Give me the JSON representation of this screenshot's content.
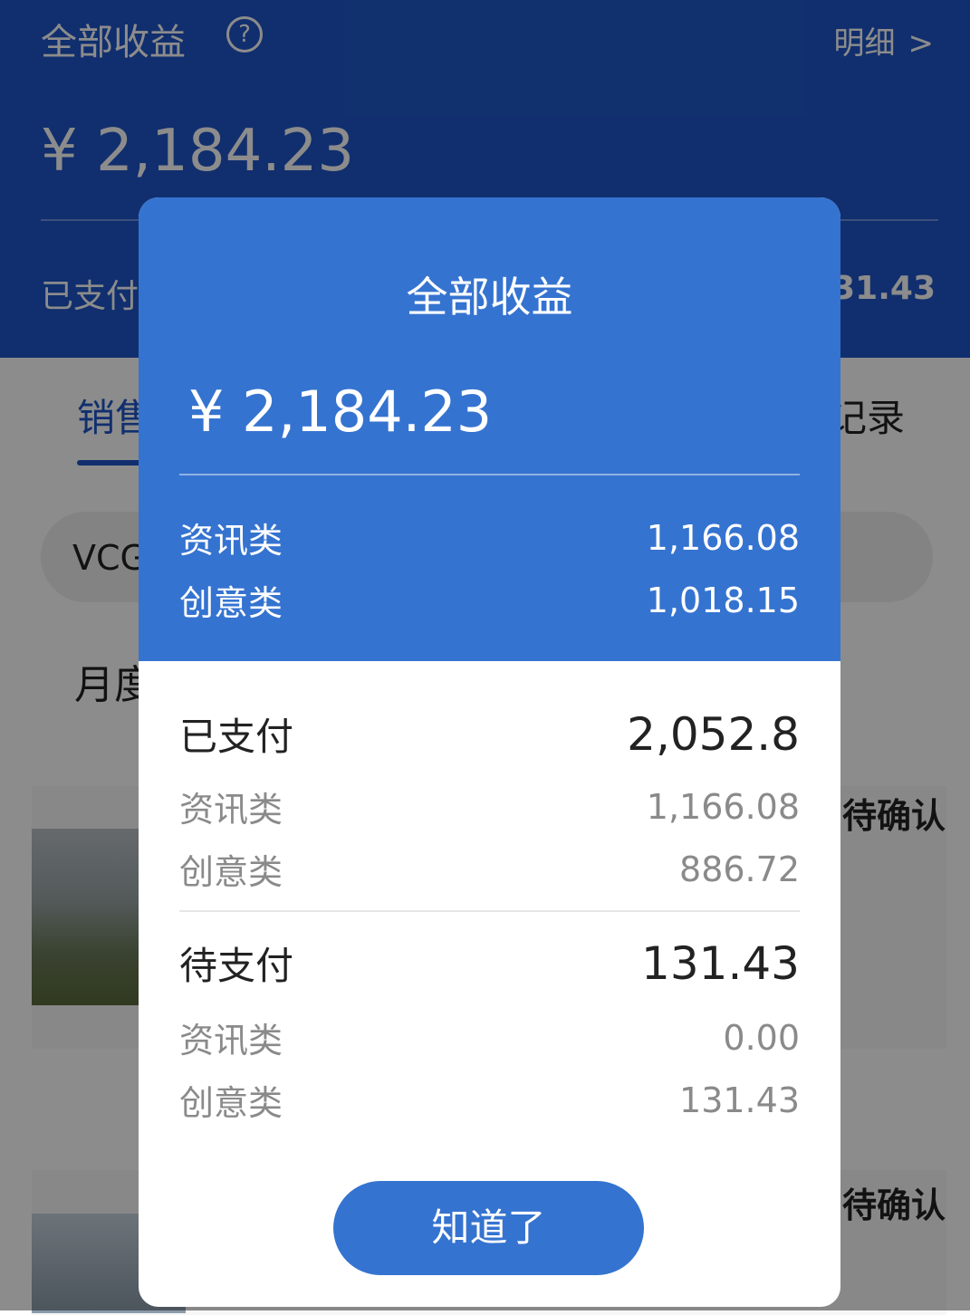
{
  "header": {
    "title": "全部收益",
    "help_icon": "?",
    "detail_label": "明细",
    "detail_chevron": ">",
    "total_amount": "¥ 2,184.23",
    "paid_label_partial": "已支付",
    "pending_value_partial": "31.43"
  },
  "tabs": {
    "left_partial": "销售",
    "right_partial": "记录"
  },
  "search": {
    "text_partial": "VCG"
  },
  "month_partial": "月度",
  "list": {
    "status_1": "待确认",
    "status_2": "待确认"
  },
  "modal": {
    "title": "全部收益",
    "total": "¥  2,184.23",
    "breakdown": [
      {
        "label": "资讯类",
        "value": "1,166.08"
      },
      {
        "label": "创意类",
        "value": "1,018.15"
      }
    ],
    "paid": {
      "label": "已支付",
      "value": "2,052.8",
      "items": [
        {
          "label": "资讯类",
          "value": "1,166.08"
        },
        {
          "label": "创意类",
          "value": "886.72"
        }
      ]
    },
    "pending": {
      "label": "待支付",
      "value": "131.43",
      "items": [
        {
          "label": "资讯类",
          "value": "0.00"
        },
        {
          "label": "创意类",
          "value": "131.43"
        }
      ]
    },
    "confirm_label": "知道了"
  },
  "colors": {
    "header_blue": "#1f57c8",
    "modal_blue": "#3573d0"
  }
}
